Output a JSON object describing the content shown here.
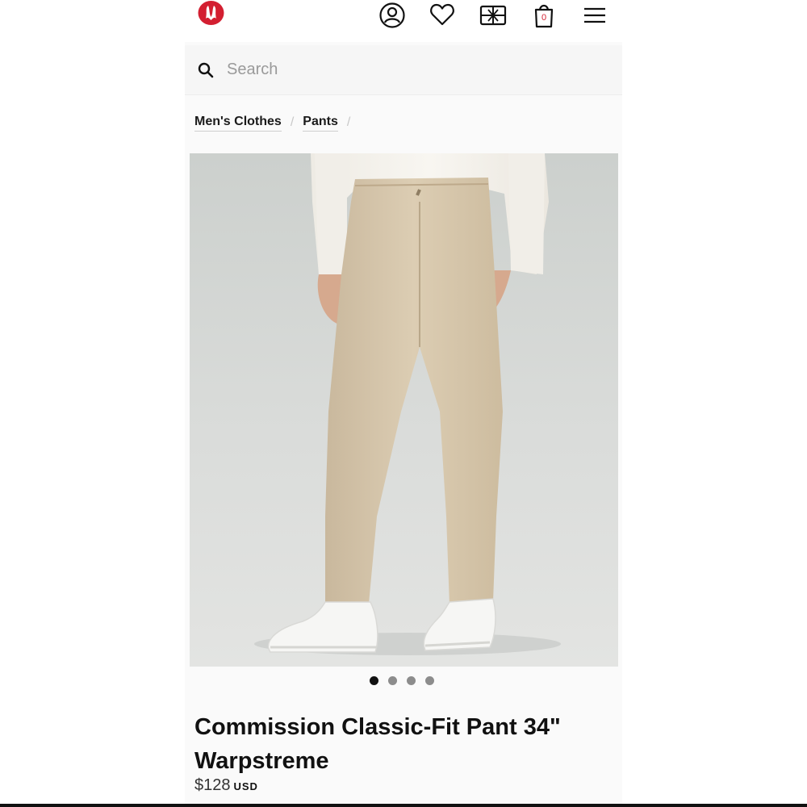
{
  "header": {
    "logo_alt": "lululemon logo",
    "icons": [
      "account-icon",
      "wishlist-icon",
      "gift-card-icon",
      "shopping-bag-icon",
      "menu-icon"
    ],
    "bag_count": "0",
    "brand_color": "#d31f31"
  },
  "search": {
    "placeholder": "Search"
  },
  "breadcrumb": {
    "items": [
      {
        "label": "Men's Clothes"
      },
      {
        "label": "Pants"
      }
    ],
    "separator": "/"
  },
  "product": {
    "title": "Commission Classic-Fit Pant 34\" Warpstreme",
    "price": "$128",
    "currency": "USD",
    "image_count": 4,
    "active_image": 1
  }
}
